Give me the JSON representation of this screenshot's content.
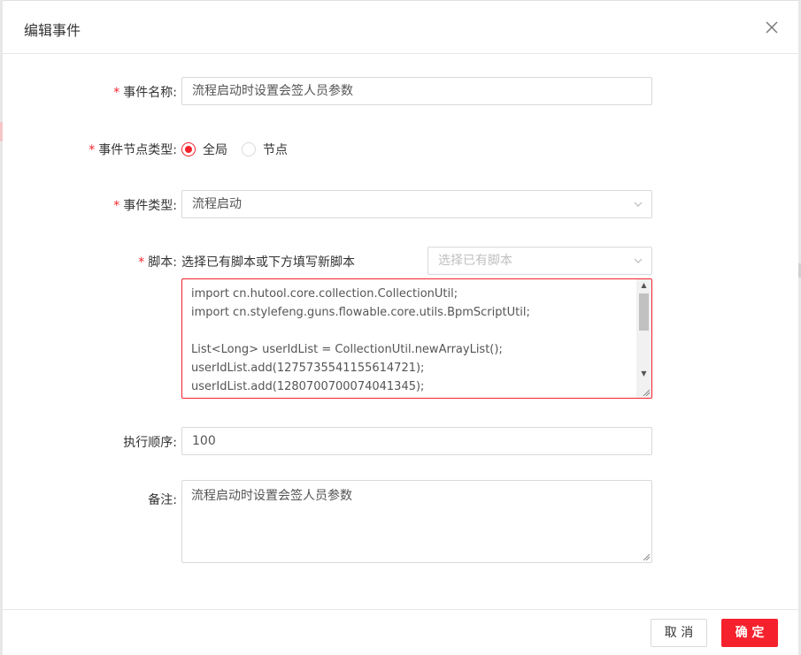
{
  "dialog": {
    "title": "编辑事件",
    "close_symbol": "✕"
  },
  "form": {
    "event_name": {
      "required_mark": "*",
      "label": "事件名称:",
      "value": "流程启动时设置会签人员参数"
    },
    "node_type": {
      "required_mark": "*",
      "label": "事件节点类型:",
      "options": [
        {
          "label": "全局",
          "checked": true
        },
        {
          "label": "节点",
          "checked": false
        }
      ]
    },
    "event_type": {
      "required_mark": "*",
      "label": "事件类型:",
      "value": "流程启动"
    },
    "script": {
      "required_mark": "*",
      "label": "脚本:",
      "hint": "选择已有脚本或下方填写新脚本",
      "select_placeholder": "选择已有脚本",
      "code_lines": [
        "import cn.hutool.core.collection.CollectionUtil;",
        "import cn.stylefeng.guns.flowable.core.utils.BpmScriptUtil;",
        "",
        "List<Long> userIdList = CollectionUtil.newArrayList();",
        "userIdList.add(1275735541155614721);",
        "userIdList.add(1280700700074041345);"
      ]
    },
    "order": {
      "label": "执行顺序:",
      "value": "100"
    },
    "remark": {
      "label": "备注:",
      "value": "流程启动时设置会签人员参数"
    }
  },
  "footer": {
    "cancel_label": "取 消",
    "ok_label": "确 定"
  },
  "colors": {
    "accent": "#f5222d",
    "border": "#d9d9d9"
  }
}
